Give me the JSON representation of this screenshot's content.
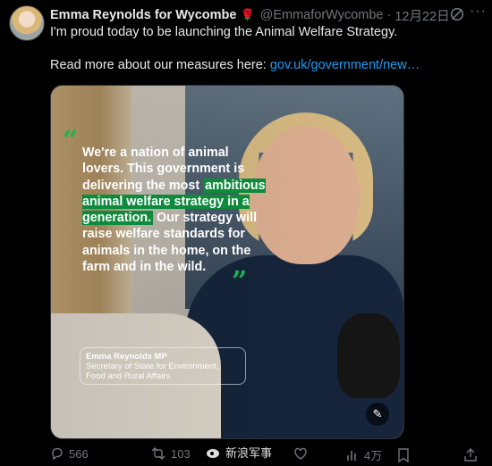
{
  "tweet": {
    "author_name": "Emma Reynolds for Wycombe",
    "rose": "🌹",
    "handle": "@EmmaforWycombe",
    "separator": "·",
    "date": "12月22日",
    "text_line1": "I'm proud today to be launching the Animal Welfare Strategy.",
    "text_line2_prefix": "Read more about our measures here: ",
    "text_link": "gov.uk/government/new…"
  },
  "media": {
    "quote_open": "“",
    "quote_part1": "We're a nation of animal lovers. This government is delivering the most ",
    "quote_highlight": "ambitious animal welfare strategy in a generation.",
    "quote_part2": " Our strategy will raise welfare standards for animals in the home, on the farm and in the wild.",
    "quote_close": "”",
    "attrib_name": "Emma Reynolds MP",
    "attrib_title": "Secretary of State for Environment, Food and Rural Affairs",
    "highlight_color": "#0d8a3c"
  },
  "actions": {
    "replies": "566",
    "reposts": "103",
    "likes": "",
    "views": "4万"
  },
  "watermark": {
    "text": "新浪军事"
  },
  "icons": [
    "grok-icon",
    "more-icon",
    "reply-icon",
    "repost-icon",
    "like-icon",
    "views-icon",
    "bookmark-icon",
    "share-icon",
    "alt-text-icon",
    "weibo-icon"
  ]
}
